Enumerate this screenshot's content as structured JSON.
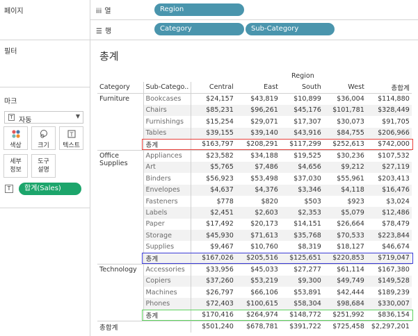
{
  "left_pane": {
    "pages_title": "페이지",
    "filters_title": "필터",
    "marks_title": "마크",
    "marks_type": "자동",
    "mark_buttons": [
      {
        "label": "색상",
        "icon": "color-dots-icon"
      },
      {
        "label": "크기",
        "icon": "size-icon"
      },
      {
        "label": "텍스트",
        "icon": "text-icon"
      },
      {
        "label": "세부\n정보",
        "icon": "detail-icon"
      },
      {
        "label": "도구\n설명",
        "icon": "tooltip-icon"
      }
    ],
    "sum_pill": "합계(Sales)"
  },
  "shelves": {
    "columns_label": "열",
    "columns_pills": [
      "Region"
    ],
    "rows_label": "행",
    "rows_pills": [
      "Category",
      "Sub-Category"
    ]
  },
  "sheet": {
    "title": "총계",
    "region_header": "Region",
    "headers": [
      "Category",
      "Sub-Catego..",
      "Central",
      "East",
      "South",
      "West",
      "총합계"
    ],
    "groups": [
      {
        "category": "Furniture",
        "rows": [
          [
            "Bookcases",
            "$24,157",
            "$43,819",
            "$10,899",
            "$36,004",
            "$114,880"
          ],
          [
            "Chairs",
            "$85,231",
            "$96,261",
            "$45,176",
            "$101,781",
            "$328,449"
          ],
          [
            "Furnishings",
            "$15,254",
            "$29,071",
            "$17,307",
            "$30,073",
            "$91,705"
          ],
          [
            "Tables",
            "$39,155",
            "$39,140",
            "$43,916",
            "$84,755",
            "$206,966"
          ]
        ],
        "total": [
          "총계",
          "$163,797",
          "$208,291",
          "$117,299",
          "$252,613",
          "$742,000"
        ]
      },
      {
        "category": "Office Supplies",
        "rows": [
          [
            "Appliances",
            "$23,582",
            "$34,188",
            "$19,525",
            "$30,236",
            "$107,532"
          ],
          [
            "Art",
            "$5,765",
            "$7,486",
            "$4,656",
            "$9,212",
            "$27,119"
          ],
          [
            "Binders",
            "$56,923",
            "$53,498",
            "$37,030",
            "$55,961",
            "$203,413"
          ],
          [
            "Envelopes",
            "$4,637",
            "$4,376",
            "$3,346",
            "$4,118",
            "$16,476"
          ],
          [
            "Fasteners",
            "$778",
            "$820",
            "$503",
            "$923",
            "$3,024"
          ],
          [
            "Labels",
            "$2,451",
            "$2,603",
            "$2,353",
            "$5,079",
            "$12,486"
          ],
          [
            "Paper",
            "$17,492",
            "$20,173",
            "$14,151",
            "$26,664",
            "$78,479"
          ],
          [
            "Storage",
            "$45,930",
            "$71,613",
            "$35,768",
            "$70,533",
            "$223,844"
          ],
          [
            "Supplies",
            "$9,467",
            "$10,760",
            "$8,319",
            "$18,127",
            "$46,674"
          ]
        ],
        "total": [
          "총계",
          "$167,026",
          "$205,516",
          "$125,651",
          "$220,853",
          "$719,047"
        ]
      },
      {
        "category": "Technology",
        "rows": [
          [
            "Accessories",
            "$33,956",
            "$45,033",
            "$27,277",
            "$61,114",
            "$167,380"
          ],
          [
            "Copiers",
            "$37,260",
            "$53,219",
            "$9,300",
            "$49,749",
            "$149,528"
          ],
          [
            "Machines",
            "$26,797",
            "$66,106",
            "$53,891",
            "$42,444",
            "$189,239"
          ],
          [
            "Phones",
            "$72,403",
            "$100,615",
            "$58,304",
            "$98,684",
            "$330,007"
          ]
        ],
        "total": [
          "총계",
          "$170,416",
          "$264,974",
          "$148,772",
          "$251,992",
          "$836,154"
        ]
      }
    ],
    "grand_total": [
      "총합계",
      "$501,240",
      "$678,781",
      "$391,722",
      "$725,458",
      "$2,297,201"
    ],
    "highlight_colors": [
      "#e8403a",
      "#3a3ad8",
      "#5fd35f"
    ]
  },
  "colors": {
    "pill_blue": "#4a95ad",
    "pill_green": "#1ca56b"
  }
}
